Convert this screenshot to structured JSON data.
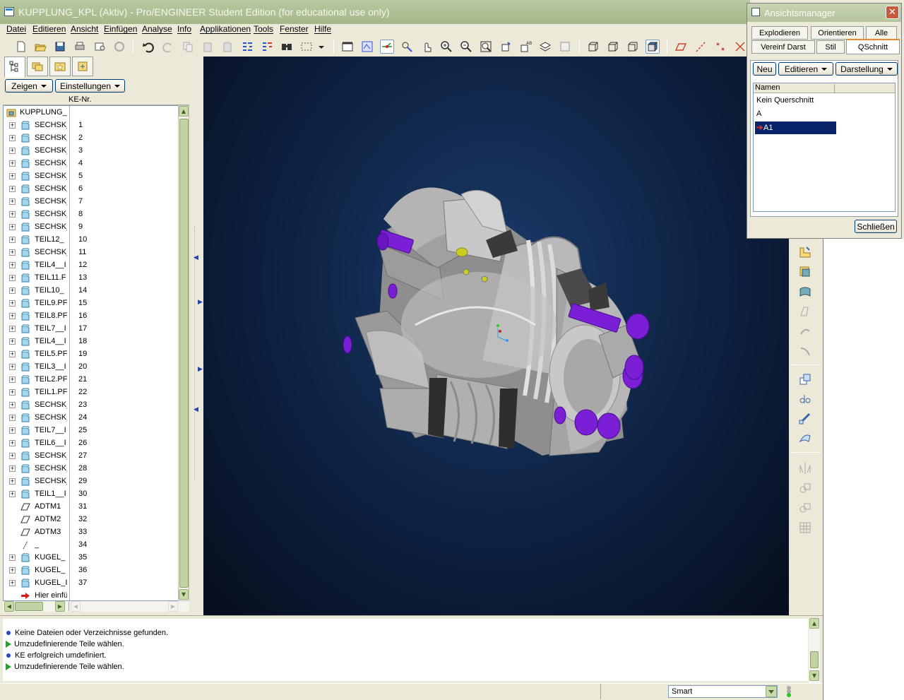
{
  "window": {
    "title": "KUPPLUNG_KPL (Aktiv) - Pro/ENGINEER Student Edition (for educational use only)"
  },
  "menu": {
    "items": [
      "Datei",
      "Editieren",
      "Ansicht",
      "Einfügen",
      "Analyse",
      "Info",
      "Applikationen",
      "Tools",
      "Fenster",
      "Hilfe"
    ]
  },
  "toolbar": {
    "icons": [
      "new-file-icon",
      "open-icon",
      "save-icon",
      "print-icon",
      "send-icon",
      "regenerate-icon",
      "undo-icon",
      "redo-icon",
      "copy-icon",
      "paste-icon",
      "paste-special-icon",
      "feature-list-icon",
      "model-tree-list-icon",
      "find-icon",
      "select-box-icon",
      "dropdown-icon",
      "section-icon",
      "view-toggle-icon",
      "axis-display-icon",
      "datum-toggle-icon",
      "spin-center-icon",
      "zoom-in-icon",
      "zoom-out-icon",
      "refit-icon",
      "orient-icon",
      "named-views-icon",
      "layers-icon",
      "appearance-icon",
      "wireframe-icon",
      "hidden-line-icon",
      "no-hidden-icon",
      "shading-icon",
      "datum-plane-icon",
      "datum-axis-icon",
      "datum-point-icon",
      "coordinate-system-icon"
    ]
  },
  "left_panel": {
    "zeigen_label": "Zeigen",
    "einstellungen_label": "Einstellungen",
    "column_header": "KE-Nr.",
    "root": "KUPPLUNG_",
    "rows": [
      {
        "name": "SECHSK_",
        "num": "1",
        "type": "part"
      },
      {
        "name": "SECHSK_",
        "num": "2",
        "type": "part"
      },
      {
        "name": "SECHSK_",
        "num": "3",
        "type": "part"
      },
      {
        "name": "SECHSK_",
        "num": "4",
        "type": "part"
      },
      {
        "name": "SECHSK_",
        "num": "5",
        "type": "part"
      },
      {
        "name": "SECHSK_",
        "num": "6",
        "type": "part"
      },
      {
        "name": "SECHSK_",
        "num": "7",
        "type": "part"
      },
      {
        "name": "SECHSK_",
        "num": "8",
        "type": "part"
      },
      {
        "name": "SECHSK_",
        "num": "9",
        "type": "part"
      },
      {
        "name": "TEIL12_",
        "num": "10",
        "type": "part"
      },
      {
        "name": "SECHSK_",
        "num": "11",
        "type": "part"
      },
      {
        "name": "TEIL4__I",
        "num": "12",
        "type": "part"
      },
      {
        "name": "TEIL11.F",
        "num": "13",
        "type": "part"
      },
      {
        "name": "TEIL10_",
        "num": "14",
        "type": "part"
      },
      {
        "name": "TEIL9.PF",
        "num": "15",
        "type": "part"
      },
      {
        "name": "TEIL8.PF",
        "num": "16",
        "type": "part"
      },
      {
        "name": "TEIL7__I",
        "num": "17",
        "type": "part"
      },
      {
        "name": "TEIL4__I",
        "num": "18",
        "type": "part"
      },
      {
        "name": "TEIL5.PF",
        "num": "19",
        "type": "part"
      },
      {
        "name": "TEIL3__I",
        "num": "20",
        "type": "part"
      },
      {
        "name": "TEIL2.PF",
        "num": "21",
        "type": "part"
      },
      {
        "name": "TEIL1.PF",
        "num": "22",
        "type": "part"
      },
      {
        "name": "SECHSK_",
        "num": "23",
        "type": "part"
      },
      {
        "name": "SECHSK_",
        "num": "24",
        "type": "part"
      },
      {
        "name": "TEIL7__I",
        "num": "25",
        "type": "part"
      },
      {
        "name": "TEIL6__I",
        "num": "26",
        "type": "part"
      },
      {
        "name": "SECHSK_",
        "num": "27",
        "type": "part"
      },
      {
        "name": "SECHSK_",
        "num": "28",
        "type": "part"
      },
      {
        "name": "SECHSK_",
        "num": "29",
        "type": "part"
      },
      {
        "name": "TEIL1__I",
        "num": "30",
        "type": "part"
      },
      {
        "name": "ADTM1",
        "num": "31",
        "type": "datum"
      },
      {
        "name": "ADTM2",
        "num": "32",
        "type": "datum"
      },
      {
        "name": "ADTM3",
        "num": "33",
        "type": "datum"
      },
      {
        "name": "_",
        "num": "34",
        "type": "axis"
      },
      {
        "name": "KUGEL_",
        "num": "35",
        "type": "part"
      },
      {
        "name": "KUGEL_",
        "num": "36",
        "type": "part"
      },
      {
        "name": "KUGEL_I",
        "num": "37",
        "type": "part"
      },
      {
        "name": "Hier einfü",
        "num": "",
        "type": "insert"
      }
    ]
  },
  "dialog": {
    "title": "Ansichtsmanager",
    "tabs_row1": [
      "Explodieren",
      "Orientieren",
      "Alle"
    ],
    "tabs_row2": [
      "Vereinf Darst",
      "Stil",
      "QSchnitt"
    ],
    "active_tab": "QSchnitt",
    "btn_neu": "Neu",
    "btn_editieren": "Editieren",
    "btn_darstellung": "Darstellung",
    "list_header": "Namen",
    "list_items": [
      "Kein Querschnitt",
      "A",
      "A1"
    ],
    "selected_item": "A1",
    "close_label": "Schließen"
  },
  "messages": [
    {
      "type": "info",
      "text": "Keine Dateien oder Verzeichnisse gefunden."
    },
    {
      "type": "prompt",
      "text": "Umzudefinierende Teile wählen."
    },
    {
      "type": "info",
      "text": "KE erfolgreich umdefiniert."
    },
    {
      "type": "prompt",
      "text": "Umzudefinierende Teile wählen."
    }
  ],
  "status": {
    "filter_value": "Smart"
  },
  "colors": {
    "viewport_bg": "#0d2040",
    "bolt": "#7a1fd6",
    "model_gray": "#a8a8a8",
    "selection": "#0a246a"
  }
}
